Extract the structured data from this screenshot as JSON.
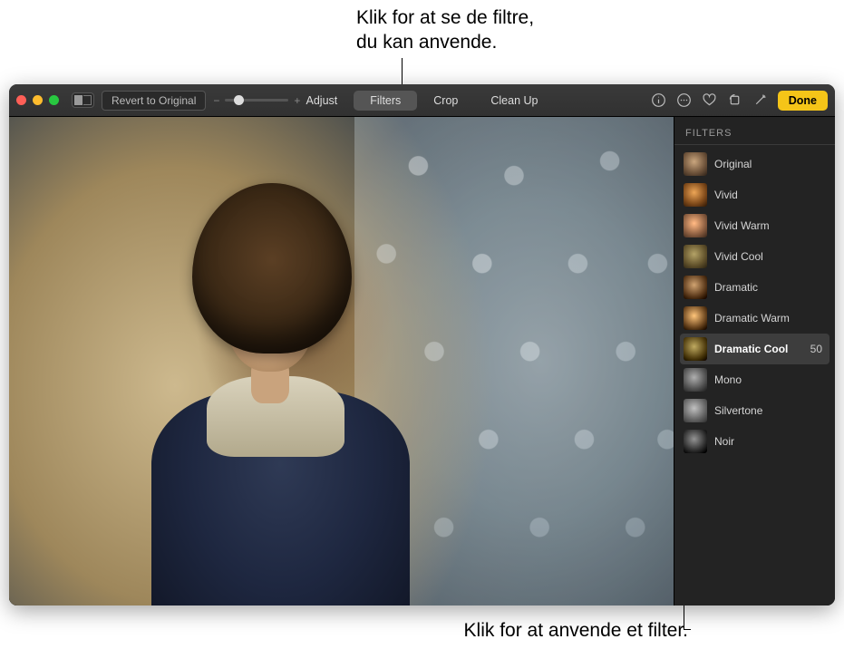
{
  "annotations": {
    "top": "Klik for at se de filtre,\ndu kan anvende.",
    "bottom": "Klik for at anvende et filter."
  },
  "toolbar": {
    "revert_label": "Revert to Original",
    "tabs": [
      {
        "label": "Adjust",
        "active": false
      },
      {
        "label": "Filters",
        "active": true
      },
      {
        "label": "Crop",
        "active": false
      },
      {
        "label": "Clean Up",
        "active": false
      }
    ],
    "done_label": "Done",
    "icons": [
      "info-icon",
      "more-icon",
      "favorite-icon",
      "rotate-icon",
      "wand-icon"
    ]
  },
  "sidebar": {
    "title": "FILTERS",
    "filters": [
      {
        "label": "Original",
        "thumb_class": "",
        "selected": false
      },
      {
        "label": "Vivid",
        "thumb_class": "vivid",
        "selected": false
      },
      {
        "label": "Vivid Warm",
        "thumb_class": "warm",
        "selected": false
      },
      {
        "label": "Vivid Cool",
        "thumb_class": "cool",
        "selected": false
      },
      {
        "label": "Dramatic",
        "thumb_class": "dram",
        "selected": false
      },
      {
        "label": "Dramatic Warm",
        "thumb_class": "dramwarm",
        "selected": false
      },
      {
        "label": "Dramatic Cool",
        "thumb_class": "dramcool",
        "selected": true,
        "value": "50"
      },
      {
        "label": "Mono",
        "thumb_class": "mono",
        "selected": false
      },
      {
        "label": "Silvertone",
        "thumb_class": "silver",
        "selected": false
      },
      {
        "label": "Noir",
        "thumb_class": "noir",
        "selected": false
      }
    ]
  }
}
